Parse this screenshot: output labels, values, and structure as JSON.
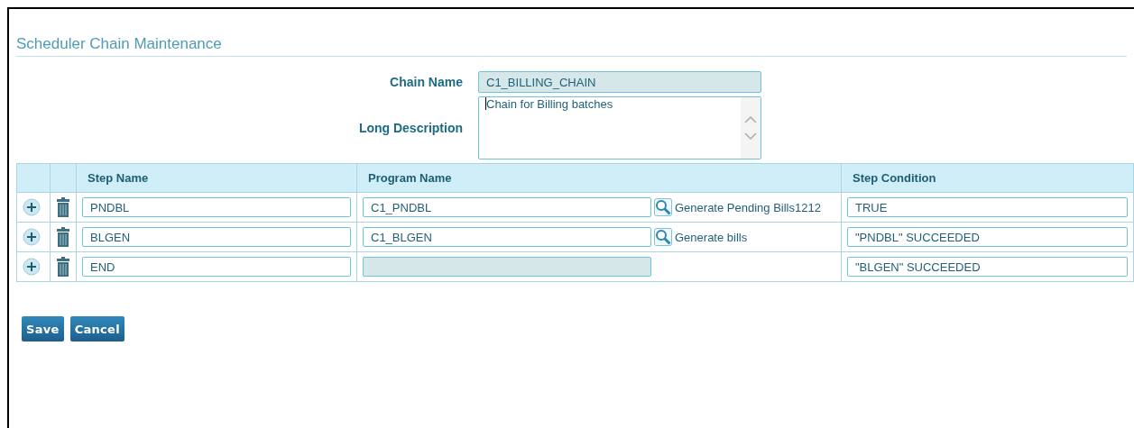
{
  "page": {
    "title": "Scheduler Chain Maintenance"
  },
  "chain_name": {
    "label": "Chain Name",
    "value": "C1_BILLING_CHAIN",
    "disabled": true
  },
  "long_description": {
    "label": "Long Description",
    "value": "Chain for Billing batches"
  },
  "table": {
    "columns": [
      "Step Name",
      "Program Name",
      "Step Condition"
    ],
    "rows": [
      {
        "step_name": "PNDBL",
        "program_name": {
          "value": "C1_PNDBL",
          "disabled": false,
          "description": "Generate Pending Bills1212"
        },
        "step_condition": "TRUE"
      },
      {
        "step_name": "BLGEN",
        "program_name": {
          "value": "C1_BLGEN",
          "disabled": false,
          "description": "Generate bills"
        },
        "step_condition": "\"PNDBL\" SUCCEEDED"
      },
      {
        "step_name": "END",
        "program_name": {
          "disabled": true
        },
        "step_condition": "\"BLGEN\" SUCCEEDED"
      }
    ]
  },
  "buttons": [
    "Save",
    "Cancel"
  ]
}
